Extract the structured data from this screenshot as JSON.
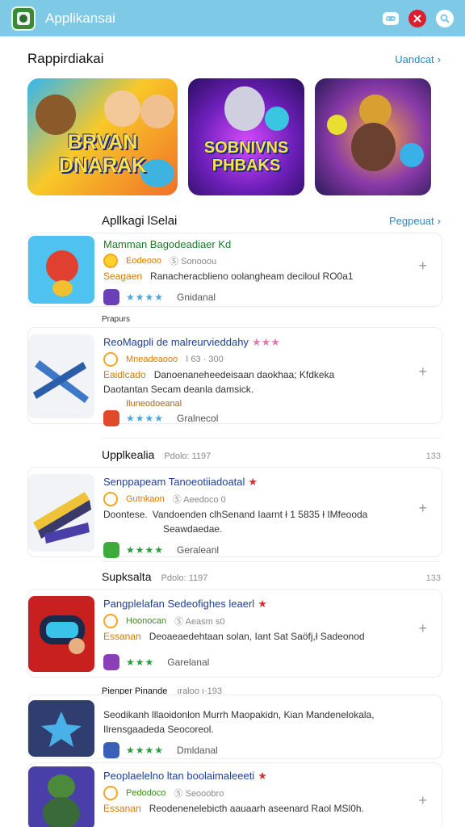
{
  "app": {
    "title": "Applikansai",
    "colors": {
      "appbar": "#7ec9e6",
      "link": "#2b86c5",
      "title_blue": "#1d3f99",
      "star_red": "#d93030",
      "star_green": "#2c9b3c"
    }
  },
  "header_icons": [
    "gamepad-icon",
    "close-icon",
    "search-icon"
  ],
  "featured": {
    "title": "Rappirdiakai",
    "link": "Uandcat",
    "cards": [
      {
        "name": "featured-card-1",
        "text": "BRVAN DNARAK"
      },
      {
        "name": "featured-card-2",
        "text": "SOBNIVNS PHBAKS"
      },
      {
        "name": "featured-card-3",
        "text": ""
      }
    ]
  },
  "apps_section": {
    "title": "Apllkagi lSelai",
    "link": "Pegpeuat"
  },
  "rows": [
    {
      "title": "Mamman Bagodeadiaer Kd",
      "meta_dev": "Eodeooo",
      "meta_sub": "Ⓢ Sonooou",
      "desc_lead": "Seagaen",
      "desc": "Ranacheracblieno oolangheam deciloul RO0a1",
      "stars": "★★★★",
      "rating": "Gnidanal"
    },
    {
      "title": "ReoMagpli de malreurvieddahy",
      "meta_dev": "Mneadeaooo",
      "meta_sub": "I 63 · 300",
      "desc_lead": "Eaidlcado",
      "desc": "Danoenaneheedeisaan daokhaa; Kfdkeka",
      "desc2": "Daotantan Secam deanla damsick.",
      "extra": "Iluneodoeanal",
      "stars": "★★★★",
      "rating": "Gralnecol"
    },
    {
      "title": "Senppapeam Tanoeotiiadoatal",
      "meta_dev": "Gutnkaon",
      "meta_sub": "Ⓢ Aeedoco 0",
      "desc_lead": "Doontese.",
      "desc": "Vandoenden clhSenand Iaarnt ł 1 5835 ł IMfeooda",
      "desc2": "Seawdaedae.",
      "stars": "★★★★",
      "rating": "Geraleanl"
    },
    {
      "title": "Pangplelafan Sedeofighes leaerl",
      "meta_dev": "Hoonocan",
      "meta_sub": "Ⓢ Aeasm s0",
      "desc_lead": "Essanan",
      "desc": "Deoaeaedehtaan solan, Iant Sat Saöfj,ł Sadeonod",
      "stars": "★★★",
      "rating": "Garelanal"
    },
    {
      "title": "",
      "desc": "Seodikanh lllaoidonlon Murrh Maopakidn, Kian Mandenelokala,",
      "desc2": "Ilrensgaadeda Seocoreol.",
      "stars": "★★★★",
      "rating": "Dmldanal"
    },
    {
      "title": "Peoplaelelno ltan boolaimaleeeti",
      "meta_dev": "Pedodoco",
      "meta_sub": "Ⓢ Seooobro",
      "desc_lead": "Essanan",
      "desc": "Reodenenelebicth aauaarh aseenard Raol MSl0h.",
      "stars": "★★★",
      "rating": ""
    }
  ],
  "sub_heads": [
    {
      "title": "Prapurs",
      "meta": ""
    },
    {
      "title": "Upplkealia",
      "meta": "Pdolo: 1197",
      "right": "133"
    },
    {
      "title": "Supksalta",
      "meta": "Pdolo: 1197",
      "right": "133"
    },
    {
      "title": "Pienper Pinande",
      "meta": "ıraloo ı·193",
      "right": ""
    }
  ],
  "plus_label": "+"
}
